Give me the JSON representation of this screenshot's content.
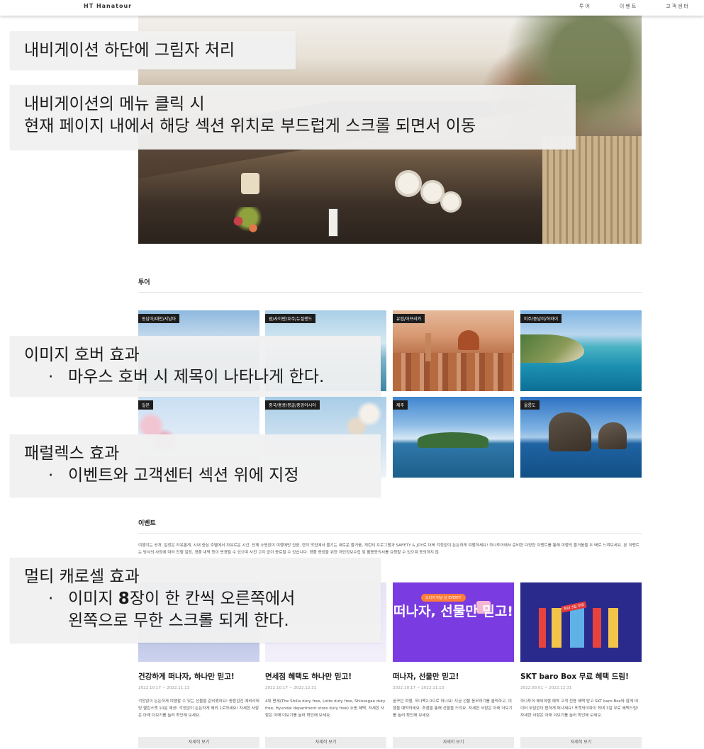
{
  "nav": {
    "brand": "HT Hanatour",
    "menu": [
      "투어",
      "이벤트",
      "고객센터"
    ]
  },
  "tour": {
    "title": "투어",
    "tiles": [
      {
        "label": "동남아/대만/서남아"
      },
      {
        "label": "괌/사이판/호주/뉴질랜드"
      },
      {
        "label": "유럽/아프리카"
      },
      {
        "label": "미주/중남미/하와이"
      },
      {
        "label": "일본"
      },
      {
        "label": "중국/홍콩/몽골/중앙아시아"
      },
      {
        "label": "제주"
      },
      {
        "label": "울릉도"
      }
    ]
  },
  "event": {
    "title": "이벤트",
    "description": "여행지는 공개, 일정은 자유롭게, 시내 중심 호텔에서 자유로운 시간, 단체 쇼핑없이 여행에만 집중, 현지 맛집에서 즐기는 새로운 즐거움, 개런티 프로그램과 SAFETY & JOY로 더욱 걱정없이 든든하게 여행하세요! 하나투어에서 준비한 다양한 이벤트를 통해 여행의 즐거움을 두 배로 느껴보세요. 본 이벤트는 당사의 사정에 따라 진행 일정, 경품 내역 등이 변경될 수 있으며 사전 고지 없이 종료될 수 있습니다. 경품 증정을 위한 개인정보수집 및 활용동의서를 요청할 수 있으며 동의하지 않",
    "cards": [
      {
        "title": "건강하게 떠나자, 하나만 믿고!",
        "date": "2022.10.17 ~ 2022.11.13",
        "text": "걱정없이 든든하게 여행할 수 있는 선물을 준비했어요! 종합검진 예비리퍼링 헬린스쳇 10분 제공! 걱정없이 든든하게 해외 1로하세요! 자세한 사항은 아래 더보기를 눌러 확인해 보세요.",
        "button": "자세히 보기"
      },
      {
        "title": "면세점 혜택도 하나만 믿고!",
        "date": "2022.10.17 ~ 2022.12.31",
        "text": "4대 면세(The Shilla duty free, Lotte duty free, Shinsegae duty free, Hyundai department store duty free) 쇼핑 혜택, 자세한 사항은 아래 더보기를 눌러 확인해 보세요.",
        "button": "자세히 보기"
      },
      {
        "title": "떠나자, 선물만 믿고!",
        "date": "2022.10.17 ~ 2022.11.13",
        "text": "꿈꾸던 여행, 하나팩2.0으로 떠나요! 지금 선물 응모하기를 클릭하고, 여행을 예약하세요. 추첨을 통해 선물을 드려요. 자세한 사항은 아래 더보기를 눌러 확인해 보세요.",
        "button": "자세히 보기",
        "image_bubble": "드디어 떠날 날 EVENT!",
        "image_text": "떠나자, 선물만 믿고!"
      },
      {
        "title": "SKT baro Box 무료 혜택 드림!",
        "date": "2022.08.01 ~ 2022.12.31",
        "text": "하나투어 해외여행 예약 고객 전용 혜택 받고 SKT baro Box와 함께 데이터 부담없이 편하게 떠나세요! 포켓와이파이 최대 3일 무료 혜택드림! 자세한 사항은 아래 더보기를 눌러 확인해 보세요.",
        "button": "자세히 보기",
        "image_badge": "최대 3일 무료"
      }
    ]
  },
  "annotations": {
    "shadow": "내비게이션 하단에 그림자 처리",
    "scroll_l1": "내비게이션의 메뉴 클릭 시",
    "scroll_l2": "현재 페이지 내에서 해당 섹션 위치로 부드럽게 스크롤 되면서 이동",
    "hover_l1": "이미지 호버 효과",
    "hover_l2": "마우스 호버 시 제목이 나타나게 한다.",
    "parallax_l1": "패럴렉스 효과",
    "parallax_l2": "이벤트와 고객센터 섹션 위에 지정",
    "carousel_l1": "멀티 캐로셀 효과",
    "carousel_l2_pre": "이미지 ",
    "carousel_l2_num": "8",
    "carousel_l2_post": "장이 한 칸씩 오른쪽에서",
    "carousel_l3": "왼쪽으로 무한 스크롤 되게 한다.",
    "bullet": "·"
  }
}
